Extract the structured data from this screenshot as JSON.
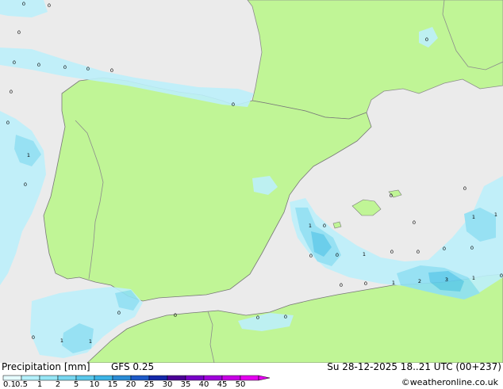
{
  "legend": {
    "title": "Precipitation [mm]",
    "model": "GFS 0.25",
    "datetime": "Su 28-12-2025 18..21 UTC (00+237)",
    "credit": "©weatheronline.co.uk",
    "ticks": [
      "0.1",
      "0.5",
      "1",
      "2",
      "5",
      "10",
      "15",
      "20",
      "25",
      "30",
      "35",
      "40",
      "45",
      "50"
    ],
    "colors": [
      "#e6fbff",
      "#b4f0fa",
      "#96e6f5",
      "#78d7f0",
      "#5ac8eb",
      "#3cb4e6",
      "#2a8cd6",
      "#1e5ac8",
      "#1428aa",
      "#4b0096",
      "#7800c8",
      "#a000dc",
      "#c800e6",
      "#e600f0"
    ]
  },
  "map": {
    "colors": {
      "sea": "#ebebeb",
      "land": "#c0f596",
      "border": "#8c8c8c",
      "coast": "#787878",
      "precip_light": "#bdf0fb",
      "precip_mid": "#8fe0f4",
      "precip_heavy": "#5ecbec"
    },
    "point_labels": [
      {
        "id": "p1",
        "value": "0"
      },
      {
        "id": "p2",
        "value": "0"
      },
      {
        "id": "p3",
        "value": "0"
      },
      {
        "id": "p4",
        "value": "0"
      },
      {
        "id": "p5",
        "value": "0"
      },
      {
        "id": "p6",
        "value": "0"
      },
      {
        "id": "p7",
        "value": "0"
      },
      {
        "id": "p8",
        "value": "0"
      },
      {
        "id": "p9",
        "value": "0"
      },
      {
        "id": "p10",
        "value": "0"
      },
      {
        "id": "p11",
        "value": "0"
      },
      {
        "id": "p12",
        "value": "1"
      },
      {
        "id": "p13",
        "value": "0"
      },
      {
        "id": "p14",
        "value": "0"
      },
      {
        "id": "p15",
        "value": "0"
      },
      {
        "id": "p16",
        "value": "1"
      },
      {
        "id": "p17",
        "value": "0"
      },
      {
        "id": "p18",
        "value": "1"
      },
      {
        "id": "p19",
        "value": "1"
      },
      {
        "id": "p20",
        "value": "0"
      },
      {
        "id": "p21",
        "value": "0"
      },
      {
        "id": "p22",
        "value": "0"
      },
      {
        "id": "p23",
        "value": "0"
      },
      {
        "id": "p24",
        "value": "0"
      },
      {
        "id": "p25",
        "value": "1"
      },
      {
        "id": "p26",
        "value": "0"
      },
      {
        "id": "p27",
        "value": "0"
      },
      {
        "id": "p28",
        "value": "0"
      },
      {
        "id": "p29",
        "value": "0"
      },
      {
        "id": "p30",
        "value": "0"
      },
      {
        "id": "p31",
        "value": "1"
      },
      {
        "id": "p32",
        "value": "2"
      },
      {
        "id": "p33",
        "value": "3"
      },
      {
        "id": "p34",
        "value": "1"
      },
      {
        "id": "p35",
        "value": "0"
      },
      {
        "id": "p36",
        "value": "0"
      },
      {
        "id": "p37",
        "value": "0"
      },
      {
        "id": "p38",
        "value": "0"
      },
      {
        "id": "p39",
        "value": "1"
      },
      {
        "id": "p40",
        "value": "1"
      },
      {
        "id": "p41",
        "value": "0"
      },
      {
        "id": "p42",
        "value": "0"
      }
    ]
  }
}
